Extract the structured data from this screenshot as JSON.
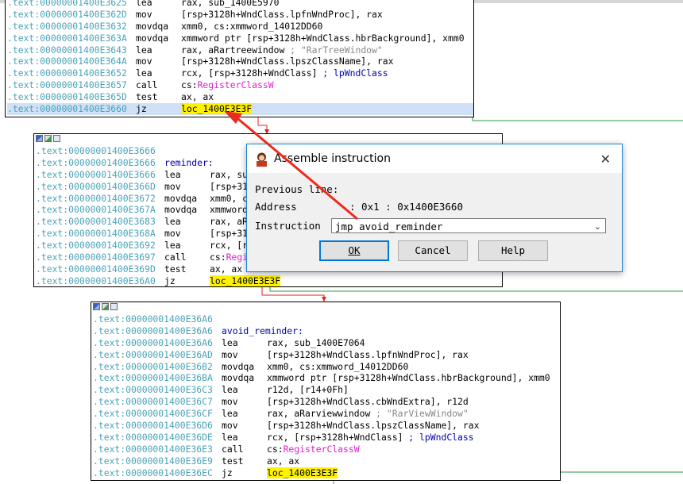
{
  "block1": {
    "lines": [
      {
        "addr": ".text:00000001400E3625",
        "mn": "lea",
        "op": "rax, sub_1400E5970"
      },
      {
        "addr": ".text:00000001400E362D",
        "mn": "mov",
        "op": "[rsp+3128h+WndClass.lpfnWndProc], rax"
      },
      {
        "addr": ".text:00000001400E3632",
        "mn": "movdqa",
        "op": "xmm0, cs:xmmword_14012DD60"
      },
      {
        "addr": ".text:00000001400E363A",
        "mn": "movdqa",
        "op": "xmmword ptr [rsp+3128h+WndClass.hbrBackground], xmm0"
      },
      {
        "addr": ".text:00000001400E3643",
        "mn": "lea",
        "op": "rax, aRartreewindow",
        "cmt": " ; \"RarTreeWindow\""
      },
      {
        "addr": ".text:00000001400E364A",
        "mn": "mov",
        "op": "[rsp+3128h+WndClass.lpszClassName], rax"
      },
      {
        "addr": ".text:00000001400E3652",
        "mn": "lea",
        "op": "rcx, [rsp+3128h+WndClass]",
        "lbl": " ; lpWndClass"
      },
      {
        "addr": ".text:00000001400E3657",
        "mn": "call",
        "op": "cs:",
        "pink": "RegisterClassW"
      },
      {
        "addr": ".text:00000001400E365D",
        "mn": "test",
        "op": "ax, ax"
      },
      {
        "addr": ".text:00000001400E3660",
        "mn": "jz",
        "hl": "loc_1400E3E3F",
        "sel": true
      }
    ]
  },
  "block2": {
    "lines": [
      {
        "addr": ".text:00000001400E3666",
        "mn": "",
        "op": ""
      },
      {
        "addr": ".text:00000001400E3666",
        "mn": "",
        "lbl": "reminder:"
      },
      {
        "addr": ".text:00000001400E3666",
        "mn": "lea",
        "op": "rax, sub_1400E7064"
      },
      {
        "addr": ".text:00000001400E366D",
        "mn": "mov",
        "op": "[rsp+3128h+WndClass.lpfnWndProc], rax"
      },
      {
        "addr": ".text:00000001400E3672",
        "mn": "movdqa",
        "op": "xmm0, cs:xmmword_14012DD60"
      },
      {
        "addr": ".text:00000001400E367A",
        "mn": "movdqa",
        "op": "xmmword ptr [rsp+3128h+WndClass.hbrBackground], xmm0"
      },
      {
        "addr": ".text:00000001400E3683",
        "mn": "lea",
        "op": "rax, aRarviewwindow"
      },
      {
        "addr": ".text:00000001400E368A",
        "mn": "mov",
        "op": "[rsp+3128h+WndClass.lpszClassName], rax"
      },
      {
        "addr": ".text:00000001400E3692",
        "mn": "lea",
        "op": "rcx, [rsp+3128h+WndClass]"
      },
      {
        "addr": ".text:00000001400E3697",
        "mn": "call",
        "op": "cs:",
        "pink": "RegisterClassW"
      },
      {
        "addr": ".text:00000001400E369D",
        "mn": "test",
        "op": "ax, ax"
      },
      {
        "addr": ".text:00000001400E36A0",
        "mn": "jz",
        "hl": "loc_1400E3E3F"
      }
    ]
  },
  "block3": {
    "lines": [
      {
        "addr": ".text:00000001400E36A6",
        "mn": "",
        "op": ""
      },
      {
        "addr": ".text:00000001400E36A6",
        "mn": "",
        "lbl": "avoid_reminder:"
      },
      {
        "addr": ".text:00000001400E36A6",
        "mn": "lea",
        "op": "rax, sub_1400E7064"
      },
      {
        "addr": ".text:00000001400E36AD",
        "mn": "mov",
        "op": "[rsp+3128h+WndClass.lpfnWndProc], rax"
      },
      {
        "addr": ".text:00000001400E36B2",
        "mn": "movdqa",
        "op": "xmm0, cs:xmmword_14012DD60"
      },
      {
        "addr": ".text:00000001400E36BA",
        "mn": "movdqa",
        "op": "xmmword ptr [rsp+3128h+WndClass.hbrBackground], xmm0"
      },
      {
        "addr": ".text:00000001400E36C3",
        "mn": "lea",
        "op": "r12d, [r14+0Fh]"
      },
      {
        "addr": ".text:00000001400E36C7",
        "mn": "mov",
        "op": "[rsp+3128h+WndClass.cbWndExtra], r12d"
      },
      {
        "addr": ".text:00000001400E36CF",
        "mn": "lea",
        "op": "rax, aRarviewwindow",
        "cmt": " ; \"RarViewWindow\""
      },
      {
        "addr": ".text:00000001400E36D6",
        "mn": "mov",
        "op": "[rsp+3128h+WndClass.lpszClassName], rax"
      },
      {
        "addr": ".text:00000001400E36DE",
        "mn": "lea",
        "op": "rcx, [rsp+3128h+WndClass]",
        "lbl": " ; lpWndClass"
      },
      {
        "addr": ".text:00000001400E36E3",
        "mn": "call",
        "op": "cs:",
        "pink": "RegisterClassW"
      },
      {
        "addr": ".text:00000001400E36E9",
        "mn": "test",
        "op": "ax, ax"
      },
      {
        "addr": ".text:00000001400E36EC",
        "mn": "jz",
        "hl": "loc_1400E3E3F"
      }
    ]
  },
  "dialog": {
    "title": "Assemble instruction",
    "close_glyph": "✕",
    "previous_label": "Previous line:",
    "address_label": "Address",
    "address_value": ": 0x1 : 0x1400E3660",
    "instruction_label": "Instruction",
    "instruction_value": "jmp avoid_reminder",
    "ok_label": "OK",
    "cancel_label": "Cancel",
    "help_label": "Help"
  },
  "colors": {
    "address": "#4aa3b8",
    "highlight": "#fff200",
    "import": "#e020d0",
    "edge_red": "#e02020",
    "edge_green": "#2a9a3a",
    "dialog_border": "#1883d7"
  }
}
